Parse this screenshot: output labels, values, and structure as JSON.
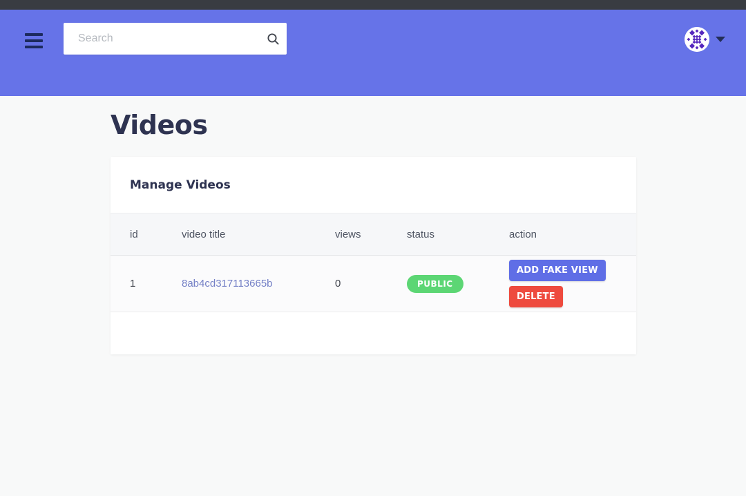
{
  "header": {
    "search": {
      "placeholder": "Search",
      "value": ""
    },
    "icons": {
      "menu": "hamburger-menu",
      "search": "magnifier",
      "avatar": "identicon-avatar",
      "caret": "chevron-down"
    }
  },
  "page": {
    "title": "Videos"
  },
  "card": {
    "title": "Manage Videos",
    "table": {
      "columns": [
        "id",
        "video title",
        "views",
        "status",
        "action"
      ],
      "rows": [
        {
          "id": "1",
          "video_title": "8ab4cd317113665b",
          "views": "0",
          "status": "PUBLIC",
          "actions": [
            "ADD FAKE VIEW",
            "DELETE"
          ]
        }
      ]
    }
  },
  "colors": {
    "top_bar": "#393c42",
    "header_background": "#6673e8",
    "page_background": "#f8f9f9",
    "heading_text": "#2e3351",
    "table_header_background": "#f6f7f9",
    "status_public": "#5cd674",
    "add_fake_view_button": "#5f6ee6",
    "delete_button": "#ee4a3e",
    "video_title_link": "#7480c6"
  }
}
